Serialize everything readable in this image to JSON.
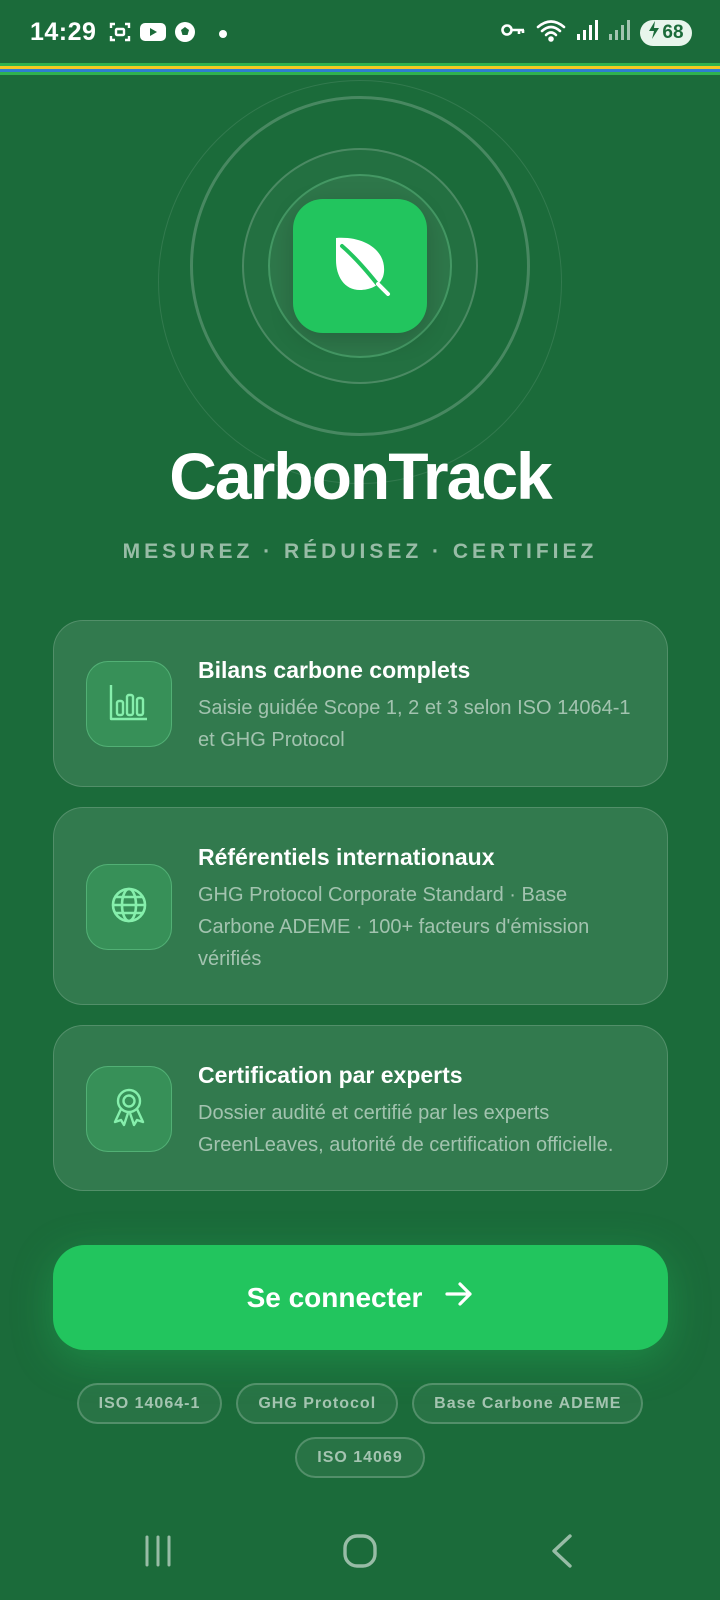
{
  "status_bar": {
    "time": "14:29",
    "battery": "68",
    "icons": [
      "screenshot-icon",
      "youtube-icon",
      "soccer-ball-icon",
      "dot-icon",
      "key-icon",
      "wifi-icon",
      "signal-icon",
      "signal-icon",
      "battery-charging-icon"
    ]
  },
  "hero": {
    "logo_icon": "leaf-icon",
    "title": "CarbonTrack",
    "tagline": "MESUREZ · RÉDUISEZ · CERTIFIEZ"
  },
  "features": [
    {
      "icon": "bar-chart-icon",
      "title": "Bilans carbone complets",
      "description": "Saisie guidée Scope 1, 2 et 3 selon ISO 14064-1 et GHG Protocol"
    },
    {
      "icon": "globe-icon",
      "title": "Référentiels internationaux",
      "description": "GHG Protocol Corporate Standard · Base Carbone ADEME · 100+ facteurs d'émission vérifiés"
    },
    {
      "icon": "award-ribbon-icon",
      "title": "Certification par experts",
      "description": "Dossier audité et certifié par les experts GreenLeaves, autorité de certification officielle."
    }
  ],
  "cta": {
    "label": "Se connecter",
    "icon": "arrow-right-icon"
  },
  "badges": [
    "ISO 14064-1",
    "GHG Protocol",
    "Base Carbone ADEME",
    "ISO 14069"
  ],
  "colors": {
    "background": "#1b6b3a",
    "accent": "#22c55e"
  },
  "nav_bar": {
    "icons": [
      "recents-icon",
      "home-icon",
      "back-icon"
    ]
  }
}
